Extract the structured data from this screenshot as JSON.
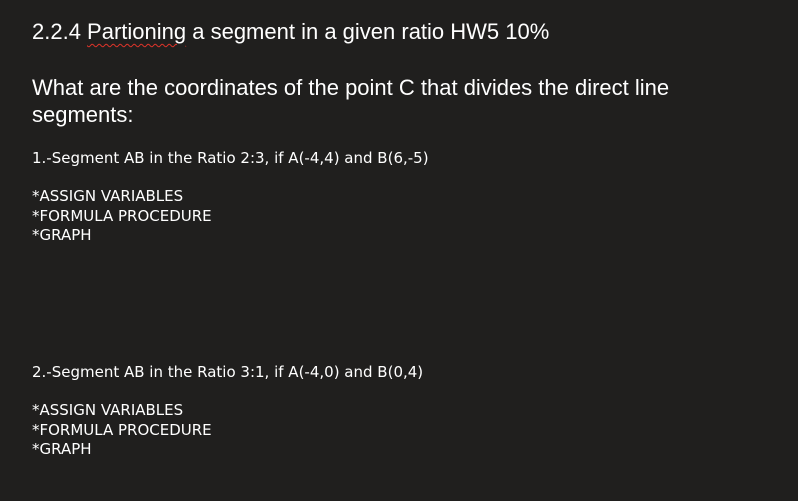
{
  "document": {
    "title": {
      "prefix": "2.2.4 ",
      "misspelled_word": "Partioning",
      "suffix": " a segment in a given ratio HW5 10%"
    },
    "question": "What are the coordinates of the point C that divides the direct line segments:",
    "problems": [
      {
        "statement": "1.-Segment AB in the Ratio 2:3, if A(-4,4) and B(6,-5)",
        "steps": [
          "*ASSIGN VARIABLES",
          "*FORMULA PROCEDURE",
          "*GRAPH"
        ]
      },
      {
        "statement": "2.-Segment AB in the Ratio 3:1, if A(-4,0) and B(0,4)",
        "steps": [
          "*ASSIGN VARIABLES",
          "*FORMULA PROCEDURE",
          "*GRAPH"
        ]
      }
    ],
    "colors": {
      "background": "#201f1e",
      "text": "#ffffff",
      "spellcheck_underline": "#e0342a"
    }
  }
}
